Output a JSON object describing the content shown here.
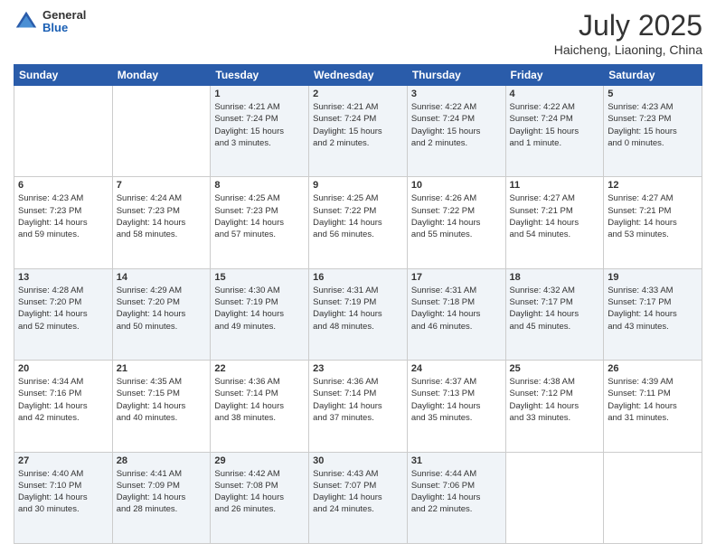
{
  "header": {
    "logo_general": "General",
    "logo_blue": "Blue",
    "month_title": "July 2025",
    "location": "Haicheng, Liaoning, China"
  },
  "days_of_week": [
    "Sunday",
    "Monday",
    "Tuesday",
    "Wednesday",
    "Thursday",
    "Friday",
    "Saturday"
  ],
  "weeks": [
    [
      {
        "day": "",
        "info": ""
      },
      {
        "day": "",
        "info": ""
      },
      {
        "day": "1",
        "info": "Sunrise: 4:21 AM\nSunset: 7:24 PM\nDaylight: 15 hours\nand 3 minutes."
      },
      {
        "day": "2",
        "info": "Sunrise: 4:21 AM\nSunset: 7:24 PM\nDaylight: 15 hours\nand 2 minutes."
      },
      {
        "day": "3",
        "info": "Sunrise: 4:22 AM\nSunset: 7:24 PM\nDaylight: 15 hours\nand 2 minutes."
      },
      {
        "day": "4",
        "info": "Sunrise: 4:22 AM\nSunset: 7:24 PM\nDaylight: 15 hours\nand 1 minute."
      },
      {
        "day": "5",
        "info": "Sunrise: 4:23 AM\nSunset: 7:23 PM\nDaylight: 15 hours\nand 0 minutes."
      }
    ],
    [
      {
        "day": "6",
        "info": "Sunrise: 4:23 AM\nSunset: 7:23 PM\nDaylight: 14 hours\nand 59 minutes."
      },
      {
        "day": "7",
        "info": "Sunrise: 4:24 AM\nSunset: 7:23 PM\nDaylight: 14 hours\nand 58 minutes."
      },
      {
        "day": "8",
        "info": "Sunrise: 4:25 AM\nSunset: 7:23 PM\nDaylight: 14 hours\nand 57 minutes."
      },
      {
        "day": "9",
        "info": "Sunrise: 4:25 AM\nSunset: 7:22 PM\nDaylight: 14 hours\nand 56 minutes."
      },
      {
        "day": "10",
        "info": "Sunrise: 4:26 AM\nSunset: 7:22 PM\nDaylight: 14 hours\nand 55 minutes."
      },
      {
        "day": "11",
        "info": "Sunrise: 4:27 AM\nSunset: 7:21 PM\nDaylight: 14 hours\nand 54 minutes."
      },
      {
        "day": "12",
        "info": "Sunrise: 4:27 AM\nSunset: 7:21 PM\nDaylight: 14 hours\nand 53 minutes."
      }
    ],
    [
      {
        "day": "13",
        "info": "Sunrise: 4:28 AM\nSunset: 7:20 PM\nDaylight: 14 hours\nand 52 minutes."
      },
      {
        "day": "14",
        "info": "Sunrise: 4:29 AM\nSunset: 7:20 PM\nDaylight: 14 hours\nand 50 minutes."
      },
      {
        "day": "15",
        "info": "Sunrise: 4:30 AM\nSunset: 7:19 PM\nDaylight: 14 hours\nand 49 minutes."
      },
      {
        "day": "16",
        "info": "Sunrise: 4:31 AM\nSunset: 7:19 PM\nDaylight: 14 hours\nand 48 minutes."
      },
      {
        "day": "17",
        "info": "Sunrise: 4:31 AM\nSunset: 7:18 PM\nDaylight: 14 hours\nand 46 minutes."
      },
      {
        "day": "18",
        "info": "Sunrise: 4:32 AM\nSunset: 7:17 PM\nDaylight: 14 hours\nand 45 minutes."
      },
      {
        "day": "19",
        "info": "Sunrise: 4:33 AM\nSunset: 7:17 PM\nDaylight: 14 hours\nand 43 minutes."
      }
    ],
    [
      {
        "day": "20",
        "info": "Sunrise: 4:34 AM\nSunset: 7:16 PM\nDaylight: 14 hours\nand 42 minutes."
      },
      {
        "day": "21",
        "info": "Sunrise: 4:35 AM\nSunset: 7:15 PM\nDaylight: 14 hours\nand 40 minutes."
      },
      {
        "day": "22",
        "info": "Sunrise: 4:36 AM\nSunset: 7:14 PM\nDaylight: 14 hours\nand 38 minutes."
      },
      {
        "day": "23",
        "info": "Sunrise: 4:36 AM\nSunset: 7:14 PM\nDaylight: 14 hours\nand 37 minutes."
      },
      {
        "day": "24",
        "info": "Sunrise: 4:37 AM\nSunset: 7:13 PM\nDaylight: 14 hours\nand 35 minutes."
      },
      {
        "day": "25",
        "info": "Sunrise: 4:38 AM\nSunset: 7:12 PM\nDaylight: 14 hours\nand 33 minutes."
      },
      {
        "day": "26",
        "info": "Sunrise: 4:39 AM\nSunset: 7:11 PM\nDaylight: 14 hours\nand 31 minutes."
      }
    ],
    [
      {
        "day": "27",
        "info": "Sunrise: 4:40 AM\nSunset: 7:10 PM\nDaylight: 14 hours\nand 30 minutes."
      },
      {
        "day": "28",
        "info": "Sunrise: 4:41 AM\nSunset: 7:09 PM\nDaylight: 14 hours\nand 28 minutes."
      },
      {
        "day": "29",
        "info": "Sunrise: 4:42 AM\nSunset: 7:08 PM\nDaylight: 14 hours\nand 26 minutes."
      },
      {
        "day": "30",
        "info": "Sunrise: 4:43 AM\nSunset: 7:07 PM\nDaylight: 14 hours\nand 24 minutes."
      },
      {
        "day": "31",
        "info": "Sunrise: 4:44 AM\nSunset: 7:06 PM\nDaylight: 14 hours\nand 22 minutes."
      },
      {
        "day": "",
        "info": ""
      },
      {
        "day": "",
        "info": ""
      }
    ]
  ]
}
